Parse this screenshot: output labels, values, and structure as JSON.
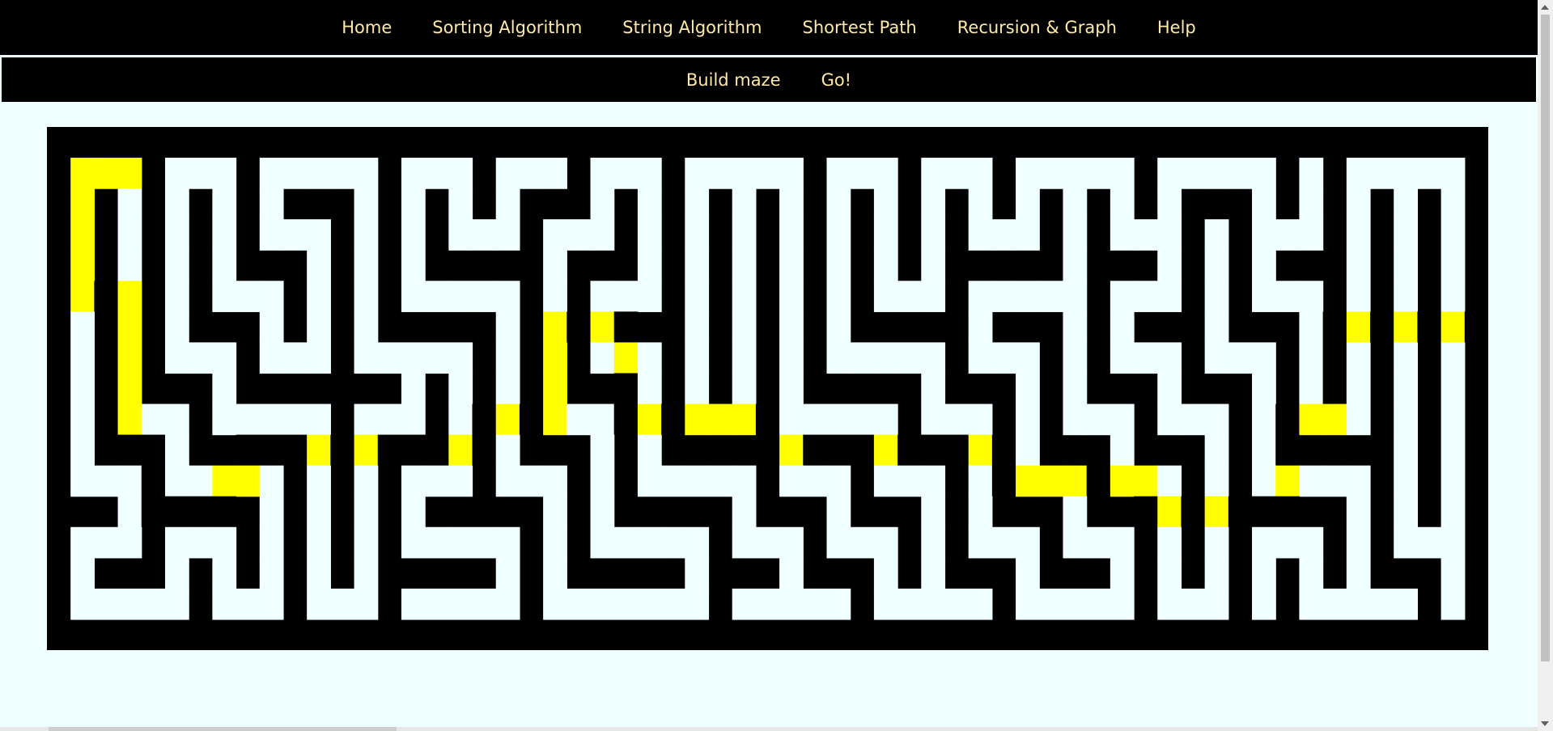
{
  "nav": {
    "items": [
      {
        "label": "Home"
      },
      {
        "label": "Sorting Algorithm"
      },
      {
        "label": "String Algorithm"
      },
      {
        "label": "Shortest Path"
      },
      {
        "label": "Recursion & Graph"
      },
      {
        "label": "Help"
      }
    ]
  },
  "subnav": {
    "build_label": "Build maze",
    "go_label": "Go!"
  },
  "colors": {
    "nav_bg": "#000000",
    "nav_text": "#ffe9a8",
    "page_bg": "#f0ffff",
    "maze_wall": "#000000",
    "maze_path": "#f0ffff",
    "solution": "#ffff00",
    "start": "#ff0000"
  },
  "maze": {
    "start": [
      3,
      2
    ],
    "wall_rows": [
      "#############################################################",
      "#...#...#.....#...#...#...#.....#...#...#.....#.....#.#.....#",
      "#.#.#.#.#.###.#.#.#.###.#.#.#.#.#.#.#.#.#.#.#.#.###.#.#.#.#.#",
      "#.#.#.#.#...#.#.#...#...#.#.#.#.#.#.#.#...#.#...#.#...#.#.#.#",
      "#.#.#.#.###.#.#.#####.###.#.#.#.#.#.#.#####.###.#.#.###.#.#.#",
      "#.#.#.#...#.#.#.....#.#...#.#.#.#.#...#.....#...#.#...#.#.#.#",
      "#.#.#.###.#.#.#####.#.#.###.#.#.#.#####.###.#.###.###.#.#.#.#",
      "#.#.#...#...#.....#.#.#...#.#.#.#.....#...#.#...#...#.#.#.#.#",
      "#.#.###.#######.#.#.#.###.#.#.#.#####.###.#.###.###.#.#.#.#.#",
      "#.#...#.....#...#.#.#...#.#...#.....#...#.#...#...#.#...#.#.#",
      "#.###.#####.#.###.#.###.#.#####.###.###.#.###.###.#.#####.#.#",
      "#...#.....#.#.#...#...#.#.....#...#...#.#...#...#.#.....#.#.#",
      "###.#####.#.#.#.#####.#.#####.###.###.#.###.###.#.#####.#.#.#",
      "#...#...#.#.#.#.....#.#.....#...#...#.#...#...#.#.#...#.#...#",
      "#.###.#.#.#.#.#####.#.#####.###.###.#.###.###.#.#.#.#.#.###.#",
      "#.....#...#...#.....#.......#.....#.....#.....#...#.#.....#.#",
      "#############################################################"
    ],
    "solution_path": [
      [
        1,
        3
      ],
      [
        1,
        2
      ],
      [
        1,
        1
      ],
      [
        2,
        1
      ],
      [
        3,
        1
      ],
      [
        4,
        1
      ],
      [
        5,
        1
      ],
      [
        5,
        2
      ],
      [
        5,
        3
      ],
      [
        6,
        3
      ],
      [
        7,
        3
      ],
      [
        8,
        3
      ],
      [
        9,
        3
      ],
      [
        10,
        3
      ],
      [
        10,
        4
      ],
      [
        11,
        4
      ],
      [
        12,
        4
      ],
      [
        12,
        5
      ],
      [
        12,
        6
      ],
      [
        12,
        7
      ],
      [
        11,
        7
      ],
      [
        11,
        8
      ],
      [
        10,
        8
      ],
      [
        10,
        9
      ],
      [
        10,
        10
      ],
      [
        10,
        11
      ],
      [
        10,
        12
      ],
      [
        10,
        13
      ],
      [
        10,
        14
      ],
      [
        10,
        15
      ],
      [
        10,
        16
      ],
      [
        10,
        17
      ],
      [
        10,
        18
      ],
      [
        9,
        18
      ],
      [
        9,
        19
      ],
      [
        9,
        20
      ],
      [
        9,
        21
      ],
      [
        8,
        21
      ],
      [
        7,
        21
      ],
      [
        6,
        21
      ],
      [
        6,
        22
      ],
      [
        6,
        23
      ],
      [
        6,
        24
      ],
      [
        7,
        24
      ],
      [
        8,
        24
      ],
      [
        9,
        24
      ],
      [
        9,
        25
      ],
      [
        9,
        26
      ],
      [
        9,
        27
      ],
      [
        9,
        28
      ],
      [
        9,
        29
      ],
      [
        9,
        30
      ],
      [
        10,
        30
      ],
      [
        10,
        31
      ],
      [
        10,
        32
      ],
      [
        10,
        33
      ],
      [
        10,
        34
      ],
      [
        10,
        35
      ],
      [
        10,
        36
      ],
      [
        10,
        37
      ],
      [
        10,
        38
      ],
      [
        10,
        39
      ],
      [
        10,
        40
      ],
      [
        11,
        40
      ],
      [
        11,
        41
      ],
      [
        11,
        42
      ],
      [
        11,
        43
      ],
      [
        11,
        44
      ],
      [
        11,
        45
      ],
      [
        11,
        46
      ],
      [
        12,
        46
      ],
      [
        12,
        47
      ],
      [
        12,
        48
      ],
      [
        12,
        49
      ],
      [
        12,
        50
      ],
      [
        12,
        51
      ],
      [
        12,
        52
      ],
      [
        11,
        52
      ],
      [
        10,
        52
      ],
      [
        9,
        52
      ],
      [
        9,
        53
      ],
      [
        9,
        54
      ],
      [
        8,
        54
      ],
      [
        7,
        54
      ],
      [
        6,
        54
      ],
      [
        6,
        55
      ],
      [
        6,
        56
      ],
      [
        6,
        57
      ],
      [
        6,
        58
      ],
      [
        6,
        59
      ],
      [
        6,
        60
      ]
    ]
  }
}
